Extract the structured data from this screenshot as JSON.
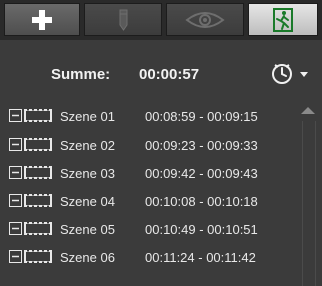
{
  "toolbar": {
    "buttons": [
      {
        "icon": "plus-icon"
      },
      {
        "icon": "pencil-icon"
      },
      {
        "icon": "eye-icon"
      },
      {
        "icon": "exit-icon"
      }
    ]
  },
  "summary": {
    "label": "Summe:",
    "value": "00:00:57",
    "clock_icon": "clock-icon",
    "dropdown_icon": "triangle-down-icon"
  },
  "scenes": [
    {
      "name": "Szene 01",
      "time": "00:08:59 - 00:09:15"
    },
    {
      "name": "Szene 02",
      "time": "00:09:23 - 00:09:33"
    },
    {
      "name": "Szene 03",
      "time": "00:09:42 - 00:09:43"
    },
    {
      "name": "Szene 04",
      "time": "00:10:08 - 00:10:18"
    },
    {
      "name": "Szene 05",
      "time": "00:10:49 - 00:10:51"
    },
    {
      "name": "Szene 06",
      "time": "00:11:24 - 00:11:42"
    }
  ],
  "colors": {
    "background": "#3b3b3b",
    "text": "#e8e8e8"
  }
}
